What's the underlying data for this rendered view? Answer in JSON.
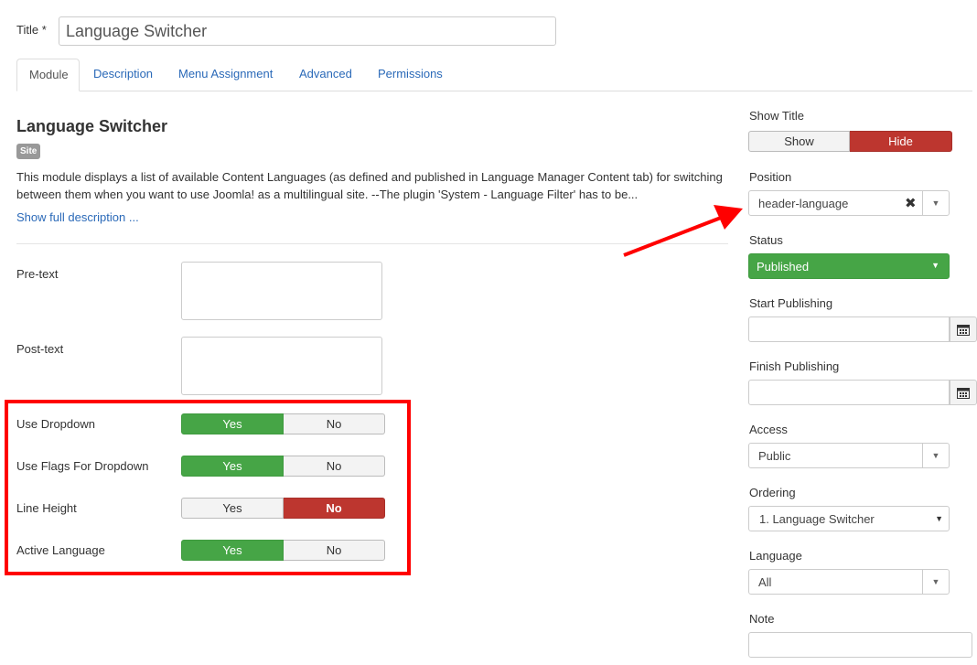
{
  "title": {
    "label": "Title *",
    "value": "Language Switcher"
  },
  "tabs": [
    {
      "label": "Module",
      "active": true
    },
    {
      "label": "Description",
      "active": false
    },
    {
      "label": "Menu Assignment",
      "active": false
    },
    {
      "label": "Advanced",
      "active": false
    },
    {
      "label": "Permissions",
      "active": false
    }
  ],
  "module": {
    "heading": "Language Switcher",
    "badge": "Site",
    "description": "This module displays a list of available Content Languages (as defined and published in Language Manager Content tab) for switching between them when you want to use Joomla! as a multilingual site. --The plugin 'System - Language Filter' has to be...",
    "show_full": "Show full description ..."
  },
  "fields": {
    "pretext": {
      "label": "Pre-text",
      "value": ""
    },
    "posttext": {
      "label": "Post-text",
      "value": ""
    },
    "use_dropdown": {
      "label": "Use Dropdown",
      "yes": "Yes",
      "no": "No",
      "selected": "yes"
    },
    "use_flags": {
      "label": "Use Flags For Dropdown",
      "yes": "Yes",
      "no": "No",
      "selected": "yes"
    },
    "line_height": {
      "label": "Line Height",
      "yes": "Yes",
      "no": "No",
      "selected": "no"
    },
    "active_language": {
      "label": "Active Language",
      "yes": "Yes",
      "no": "No",
      "selected": "yes"
    }
  },
  "sidebar": {
    "show_title": {
      "label": "Show Title",
      "show": "Show",
      "hide": "Hide",
      "selected": "hide"
    },
    "position": {
      "label": "Position",
      "value": "header-language"
    },
    "status": {
      "label": "Status",
      "value": "Published"
    },
    "start_publishing": {
      "label": "Start Publishing",
      "value": ""
    },
    "finish_publishing": {
      "label": "Finish Publishing",
      "value": ""
    },
    "access": {
      "label": "Access",
      "value": "Public"
    },
    "ordering": {
      "label": "Ordering",
      "value": "1. Language Switcher"
    },
    "language": {
      "label": "Language",
      "value": "All"
    },
    "note": {
      "label": "Note",
      "value": ""
    }
  },
  "colors": {
    "link": "#2a69b8",
    "green": "#46a546",
    "red": "#bd362f",
    "highlight": "#ff0000"
  },
  "icons": [
    "clear-x-icon",
    "caret-down-icon",
    "calendar-icon",
    "red-arrow"
  ]
}
